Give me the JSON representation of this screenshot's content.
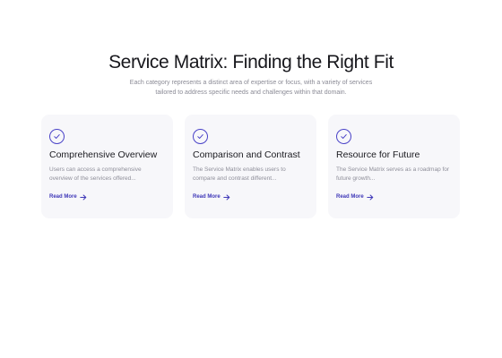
{
  "section": {
    "title": "Service Matrix: Finding the Right Fit",
    "subtitle": "Each category represents a distinct area of expertise or focus, with a variety of services tailored to address specific needs and challenges within that domain."
  },
  "colors": {
    "accent": "#4a43c8",
    "card_background": "#f7f7fa",
    "muted_text": "#8e8e99"
  },
  "cards": [
    {
      "icon": "check-circle-icon",
      "title": "Comprehensive Overview",
      "description": "Users can access a comprehensive overview of the services offered...",
      "link_label": "Read More",
      "link_icon": "arrow-right-icon"
    },
    {
      "icon": "check-circle-icon",
      "title": "Comparison and Contrast",
      "description": "The Service Matrix enables users to compare and contrast different...",
      "link_label": "Read More",
      "link_icon": "arrow-right-icon"
    },
    {
      "icon": "check-circle-icon",
      "title": "Resource for Future",
      "description": "The Service Matrix serves as a roadmap for future growth...",
      "link_label": "Read More",
      "link_icon": "arrow-right-icon"
    }
  ]
}
